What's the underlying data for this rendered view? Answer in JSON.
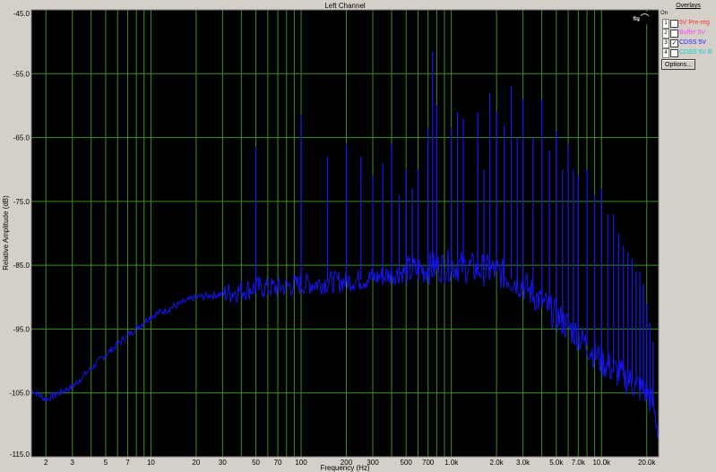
{
  "chart_data": {
    "type": "line",
    "title": "Left Channel",
    "xlabel": "Frequency (Hz)",
    "ylabel": "Relative Amplitude (dB)",
    "x_scale": "log",
    "xlim": [
      1.6,
      24000
    ],
    "ylim": [
      -115,
      -45
    ],
    "y_ticks": [
      -45.0,
      -55.0,
      -65.0,
      -75.0,
      -85.0,
      -95.0,
      -105.0,
      -115.0
    ],
    "y_tick_labels": [
      "-45.0",
      "-55.0",
      "-65.0",
      "-75.0",
      "-85.0",
      "-95.0",
      "-105.0",
      "-115.0"
    ],
    "x_ticks": [
      2,
      3,
      5,
      7,
      10,
      20,
      30,
      50,
      70,
      100,
      200,
      300,
      500,
      700,
      1000,
      2000,
      3000,
      5000,
      7000,
      10000,
      20000
    ],
    "x_tick_labels": [
      "2",
      "3",
      "5",
      "7",
      "10",
      "20",
      "30",
      "50",
      "70",
      "100",
      "200",
      "300",
      "500",
      "700",
      "1.0k",
      "2.0k",
      "3.0k",
      "5.0k",
      "7.0k",
      "10.0k",
      "20.0k"
    ],
    "grid": true,
    "series": [
      {
        "name": "CDSS 5V",
        "color": "#1414f0",
        "floor": [
          [
            1.6,
            -104.5
          ],
          [
            2,
            -106
          ],
          [
            3,
            -104
          ],
          [
            5,
            -99
          ],
          [
            7,
            -96
          ],
          [
            10,
            -93
          ],
          [
            20,
            -90
          ],
          [
            30,
            -89.5
          ],
          [
            50,
            -88.5
          ],
          [
            70,
            -88.5
          ],
          [
            100,
            -88
          ],
          [
            200,
            -87.5
          ],
          [
            300,
            -87
          ],
          [
            500,
            -86
          ],
          [
            700,
            -85.5
          ],
          [
            1000,
            -85
          ],
          [
            2000,
            -86
          ],
          [
            3000,
            -88
          ],
          [
            5000,
            -93
          ],
          [
            7000,
            -96
          ],
          [
            10000,
            -100
          ],
          [
            15000,
            -103
          ],
          [
            20000,
            -105
          ],
          [
            22000,
            -107
          ],
          [
            24000,
            -111
          ]
        ],
        "peaks": [
          [
            50,
            -66.5
          ],
          [
            100,
            -61.5
          ],
          [
            150,
            -68
          ],
          [
            200,
            -66
          ],
          [
            250,
            -68
          ],
          [
            300,
            -71
          ],
          [
            350,
            -69
          ],
          [
            400,
            -66
          ],
          [
            450,
            -74
          ],
          [
            500,
            -70
          ],
          [
            550,
            -73
          ],
          [
            600,
            -70
          ],
          [
            700,
            -63.5
          ],
          [
            750,
            -51.5
          ],
          [
            800,
            -60
          ],
          [
            1000,
            -63.5
          ],
          [
            1100,
            -61
          ],
          [
            1200,
            -62
          ],
          [
            1500,
            -61
          ],
          [
            1650,
            -70
          ],
          [
            1800,
            -58
          ],
          [
            2000,
            -61
          ],
          [
            2250,
            -63
          ],
          [
            2500,
            -57
          ],
          [
            2750,
            -65
          ],
          [
            3000,
            -59
          ],
          [
            3500,
            -65
          ],
          [
            4000,
            -59
          ],
          [
            4500,
            -67
          ],
          [
            5000,
            -64
          ],
          [
            5500,
            -70
          ],
          [
            6000,
            -66
          ],
          [
            6500,
            -70
          ],
          [
            7000,
            -71
          ],
          [
            8000,
            -70
          ],
          [
            9000,
            -74
          ],
          [
            10000,
            -73
          ],
          [
            11000,
            -77
          ],
          [
            12000,
            -77
          ],
          [
            13000,
            -80
          ],
          [
            14000,
            -82
          ],
          [
            15000,
            -83
          ],
          [
            16000,
            -84
          ],
          [
            17000,
            -86
          ],
          [
            18000,
            -86
          ],
          [
            19000,
            -88
          ],
          [
            20000,
            -91
          ],
          [
            21000,
            -94
          ],
          [
            22000,
            -97
          ]
        ]
      }
    ]
  },
  "overlays": {
    "title": "Overlays",
    "header": "On",
    "items": [
      {
        "num": "1",
        "label": "5V Pre-reg",
        "checked": false,
        "color": "#ff3030"
      },
      {
        "num": "2",
        "label": "Buffer 5V",
        "checked": false,
        "color": "#ff40ff"
      },
      {
        "num": "3",
        "label": "CDSS 5V",
        "checked": true,
        "color": "#2020ff"
      },
      {
        "num": "4",
        "label": "CDSS 5V B",
        "checked": false,
        "color": "#00d0d0"
      }
    ],
    "options_label": "Options..."
  }
}
